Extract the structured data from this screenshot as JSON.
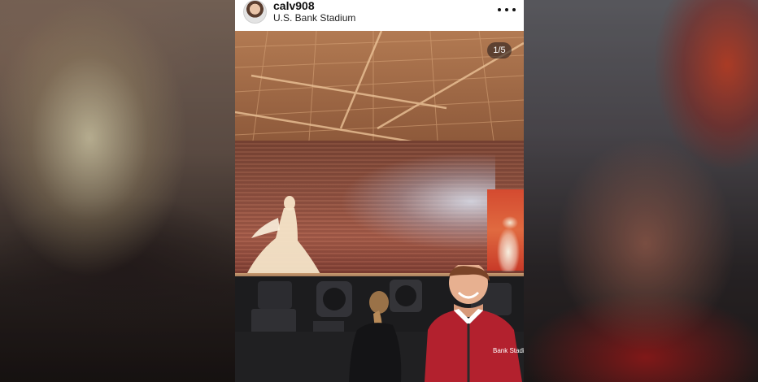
{
  "post": {
    "username": "calv908",
    "location": "U.S. Bank Stadium",
    "media_counter": "1/5",
    "more_icon": "more-horizontal-icon"
  },
  "photo": {
    "shirt_logo_text": "Bank Stadium"
  },
  "colors": {
    "card_background": "#ffffff",
    "username_text": "#111111",
    "shirt_red": "#b3212e"
  }
}
